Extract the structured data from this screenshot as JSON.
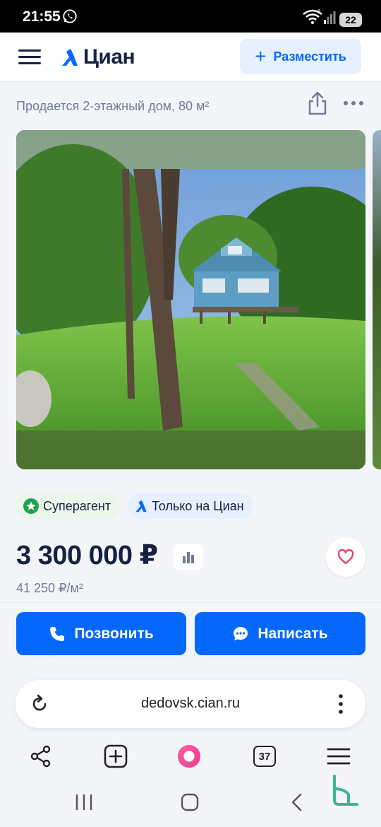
{
  "status_bar": {
    "time": "21:55",
    "battery": "22",
    "network": "6"
  },
  "header": {
    "logo": "Циан",
    "post_button": "Разместить"
  },
  "listing": {
    "subtitle": "Продается 2-этажный дом, 80 м²",
    "badges": [
      {
        "label": "Суперагент"
      },
      {
        "label": "Только на Циан"
      }
    ],
    "price": "3 300 000 ₽",
    "price_per_sqm": "41 250 ₽/м²"
  },
  "actions": {
    "call": "Позвонить",
    "write": "Написать"
  },
  "browser": {
    "url": "dedovsk.cian.ru",
    "tabs_count": "37"
  },
  "colors": {
    "brand_blue": "#0468ff",
    "text_dark": "#152242",
    "muted": "#707a95",
    "favorite_red": "#e84260",
    "superagent_green": "#1ea34f"
  },
  "icons": [
    "whatsapp-icon",
    "wifi-icon",
    "signal-icon",
    "menu-icon",
    "cian-logo-icon",
    "plus-icon",
    "share-icon",
    "more-icon",
    "star-icon",
    "chart-icon",
    "heart-icon",
    "phone-icon",
    "chat-icon",
    "reload-icon",
    "kebab-icon",
    "share-nodes-icon",
    "new-tab-icon",
    "alice-icon",
    "tabs-icon",
    "burger-icon",
    "recent-apps-icon",
    "home-icon",
    "back-icon"
  ]
}
